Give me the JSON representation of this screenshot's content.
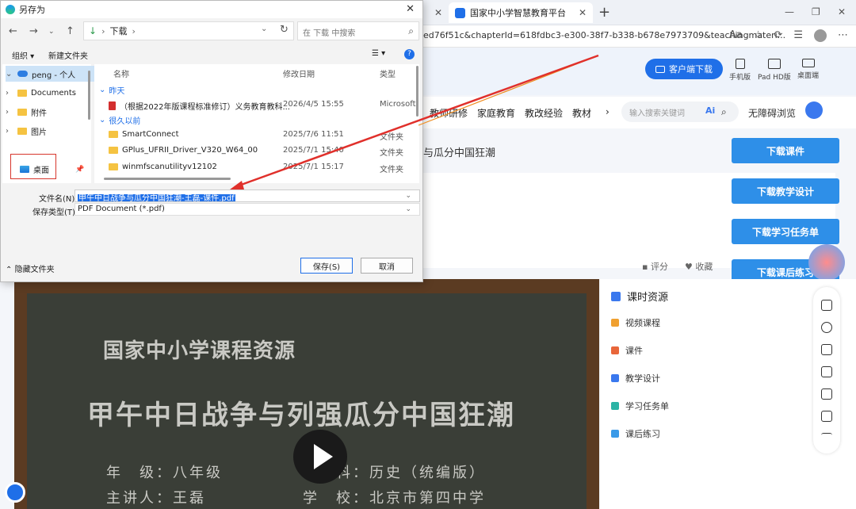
{
  "browser": {
    "active_tab_title": "国家中小学智慧教育平台",
    "url": "ed76f51c&chapterId=618fdbc3-e300-38f7-b338-b678e7973709&teachingmateri..."
  },
  "header": {
    "client_download": "客户端下载",
    "versions": [
      "手机版",
      "Pad HD版",
      "桌面端"
    ]
  },
  "nav": {
    "items": [
      "教师研修",
      "家庭教育",
      "教改经验",
      "教材"
    ],
    "search_placeholder": "输入搜索关键词",
    "ai_label": "Ai",
    "accessibility": "无障碍浏览"
  },
  "course": {
    "title": "与瓜分中国狂潮",
    "rate": "评分",
    "fav": "收藏"
  },
  "downloads": [
    "下载课件",
    "下载教学设计",
    "下载学习任务单",
    "下载课后练习"
  ],
  "resources": {
    "title": "课时资源",
    "items": [
      {
        "label": "视频课程",
        "color": "#f0a030"
      },
      {
        "label": "课件",
        "color": "#e8663a"
      },
      {
        "label": "教学设计",
        "color": "#3a78ee"
      },
      {
        "label": "学习任务单",
        "color": "#2bb3a5"
      },
      {
        "label": "课后练习",
        "color": "#3a9ae8"
      }
    ]
  },
  "video": {
    "line1": "国家中小学课程资源",
    "line2": "甲午中日战争与列强瓜分中国狂潮",
    "grade": "年　级：八年级",
    "subject": "学　科：历史（统编版）",
    "speaker": "主讲人：王磊",
    "school": "学　校：北京市第四中学"
  },
  "dialog": {
    "title": "另存为",
    "path": "下载",
    "search_placeholder": "在 下载 中搜索",
    "toolbar": {
      "organize": "组织 ▾",
      "new_folder": "新建文件夹"
    },
    "tree": [
      {
        "label": "peng - 个人",
        "kind": "cloud",
        "selected": true
      },
      {
        "label": "Documents",
        "kind": "folder"
      },
      {
        "label": "附件",
        "kind": "folder"
      },
      {
        "label": "图片",
        "kind": "folder"
      },
      {
        "label": "桌面",
        "kind": "desktop"
      }
    ],
    "columns": {
      "name": "名称",
      "date": "修改日期",
      "type": "类型"
    },
    "groups": {
      "yesterday": "昨天",
      "long_ago": "很久以前"
    },
    "files": [
      {
        "name": "（根据2022年版课程标准修订）义务教育教科...",
        "date": "2026/4/5 15:55",
        "type": "Microsoft",
        "kind": "pdf"
      },
      {
        "name": "SmartConnect",
        "date": "2025/7/6 11:51",
        "type": "文件夹",
        "kind": "folder"
      },
      {
        "name": "GPlus_UFRII_Driver_V320_W64_00",
        "date": "2025/7/1 15:40",
        "type": "文件夹",
        "kind": "folder"
      },
      {
        "name": "winmfscanutilityv12102",
        "date": "2025/7/1 15:17",
        "type": "文件夹",
        "kind": "folder"
      }
    ],
    "filename_label": "文件名(N):",
    "filename_value": "甲午中日战争与瓜分中国狂潮-王磊-课件.pdf",
    "filetype_label": "保存类型(T):",
    "filetype_value": "PDF Document (*.pdf)",
    "hide_folders": "隐藏文件夹",
    "save": "保存(S)",
    "cancel": "取消"
  }
}
